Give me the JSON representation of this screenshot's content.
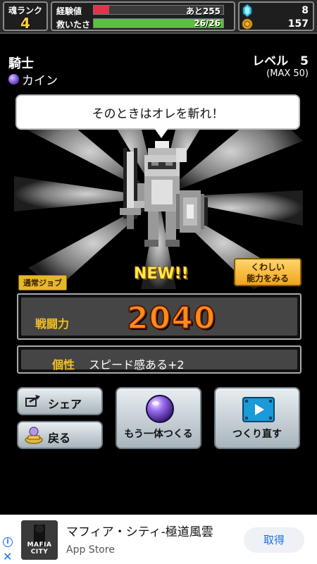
{
  "header": {
    "rank_label": "魂ランク",
    "rank_value": "4",
    "exp_label": "経験値",
    "exp_text": "あと255",
    "exp_fill_fraction": 0.12,
    "exp_color": "#e6314a",
    "rescued_label": "救いたさ",
    "rescued_text": "26/26",
    "rescued_fill_fraction": 1.0,
    "rescued_color": "#59c23a",
    "gem_count": "8",
    "coin_count": "157"
  },
  "character": {
    "job": "騎士",
    "name": "カイン",
    "level_text": "レベル　5",
    "level_max": "(MAX 50)",
    "speech": "そのときはオレを斬れ！",
    "new_label": "NEW!!",
    "job_tag": "通常ジョブ"
  },
  "details_button": {
    "line1": "くわしい",
    "line2": "能力をみる"
  },
  "power": {
    "label": "戦闘力",
    "value": "2040"
  },
  "trait": {
    "label": "個性",
    "value": "スピード感ある+2"
  },
  "buttons": {
    "share": "シェア",
    "back": "戻る",
    "another": "もう一体つくる",
    "remake": "つくり直す"
  },
  "ad": {
    "title": "マフィア・シティ-極道風雲",
    "store": "App Store",
    "cta": "取得",
    "thumb_text": "MAFIA CITY"
  }
}
